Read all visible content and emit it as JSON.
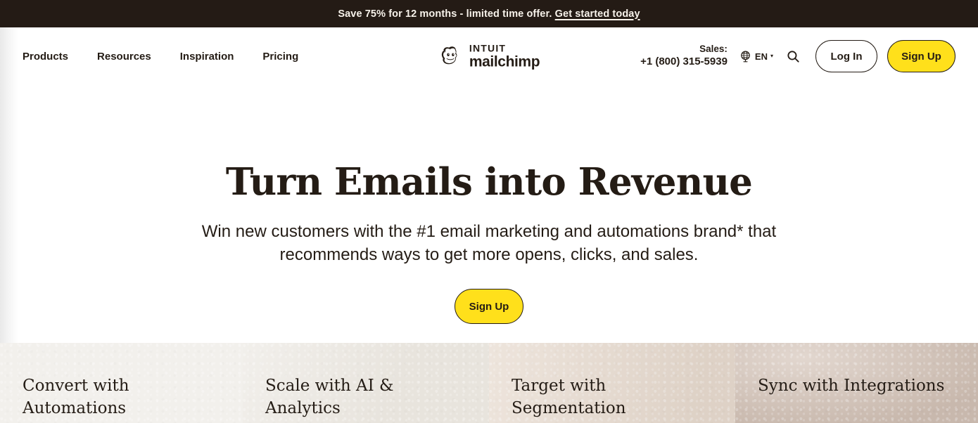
{
  "promo": {
    "text": "Save 75% for 12 months - limited time offer. ",
    "link_label": "Get started today"
  },
  "header": {
    "nav_links": [
      {
        "label": "Products"
      },
      {
        "label": "Resources"
      },
      {
        "label": "Inspiration"
      },
      {
        "label": "Pricing"
      }
    ],
    "brand": {
      "line1": "INTUIT",
      "line2": "mailchimp",
      "mark_icon": "mailchimp-freddie-icon"
    },
    "sales": {
      "label": "Sales:",
      "phone": "+1 (800) 315-5939"
    },
    "language": {
      "icon": "globe-icon",
      "code": "EN",
      "caret": "▾"
    },
    "search_icon": "search-icon",
    "login_label": "Log In",
    "signup_label": "Sign Up"
  },
  "hero": {
    "title": "Turn Emails into Revenue",
    "subtitle": "Win new customers with the #1 email marketing and automations brand* that recommends ways to get more opens, clicks, and sales.",
    "cta_label": "Sign Up"
  },
  "cards": [
    {
      "title": "Convert with Automations"
    },
    {
      "title": "Scale with AI & Analytics"
    },
    {
      "title": "Target with Segmentation"
    },
    {
      "title": "Sync with Integrations"
    }
  ],
  "colors": {
    "banner_bg": "#241b15",
    "brand_yellow": "#ffe01b",
    "ink": "#241c15",
    "card_1_bg": "#f2f0ec",
    "card_2_bg": "#e8e4dd",
    "card_3_bg": "#e6d9cd",
    "card_4_bg": "#d3c2b6"
  }
}
